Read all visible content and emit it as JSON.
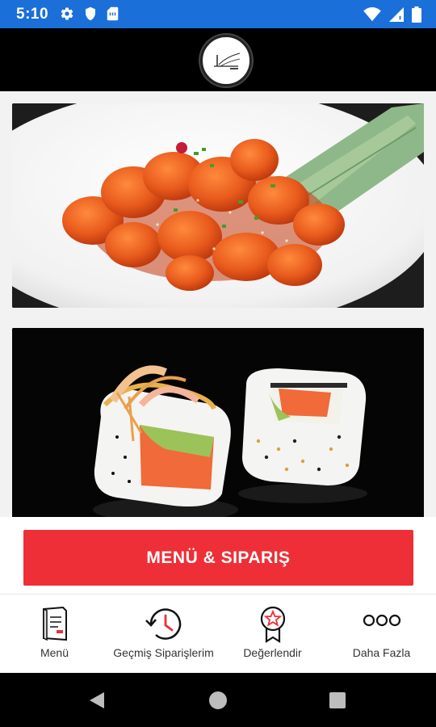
{
  "status_bar": {
    "time": "5:10",
    "left_icons": [
      "gear-icon",
      "shield-icon",
      "sim-card-icon"
    ],
    "right_icons": [
      "wifi-icon",
      "signal-icon",
      "battery-icon"
    ],
    "background_color": "#1b6fd8"
  },
  "header": {
    "logo_icon": "restaurant-logo",
    "background_color": "#000000"
  },
  "images": [
    {
      "subject": "fried-chicken-dish-photo"
    },
    {
      "subject": "sushi-rolls-photo"
    }
  ],
  "cta": {
    "label": "MENÜ & SIPARIŞ",
    "color": "#ee2f37"
  },
  "bottom_nav": {
    "items": [
      {
        "label": "Menü",
        "icon": "menu-book-icon"
      },
      {
        "label": "Geçmiş Siparişlerim",
        "icon": "history-clock-icon"
      },
      {
        "label": "Değerlendir",
        "icon": "rating-badge-icon"
      },
      {
        "label": "Daha Fazla",
        "icon": "more-dots-icon"
      }
    ]
  },
  "system_nav": {
    "buttons": [
      "back-icon",
      "home-icon",
      "recents-icon"
    ]
  }
}
